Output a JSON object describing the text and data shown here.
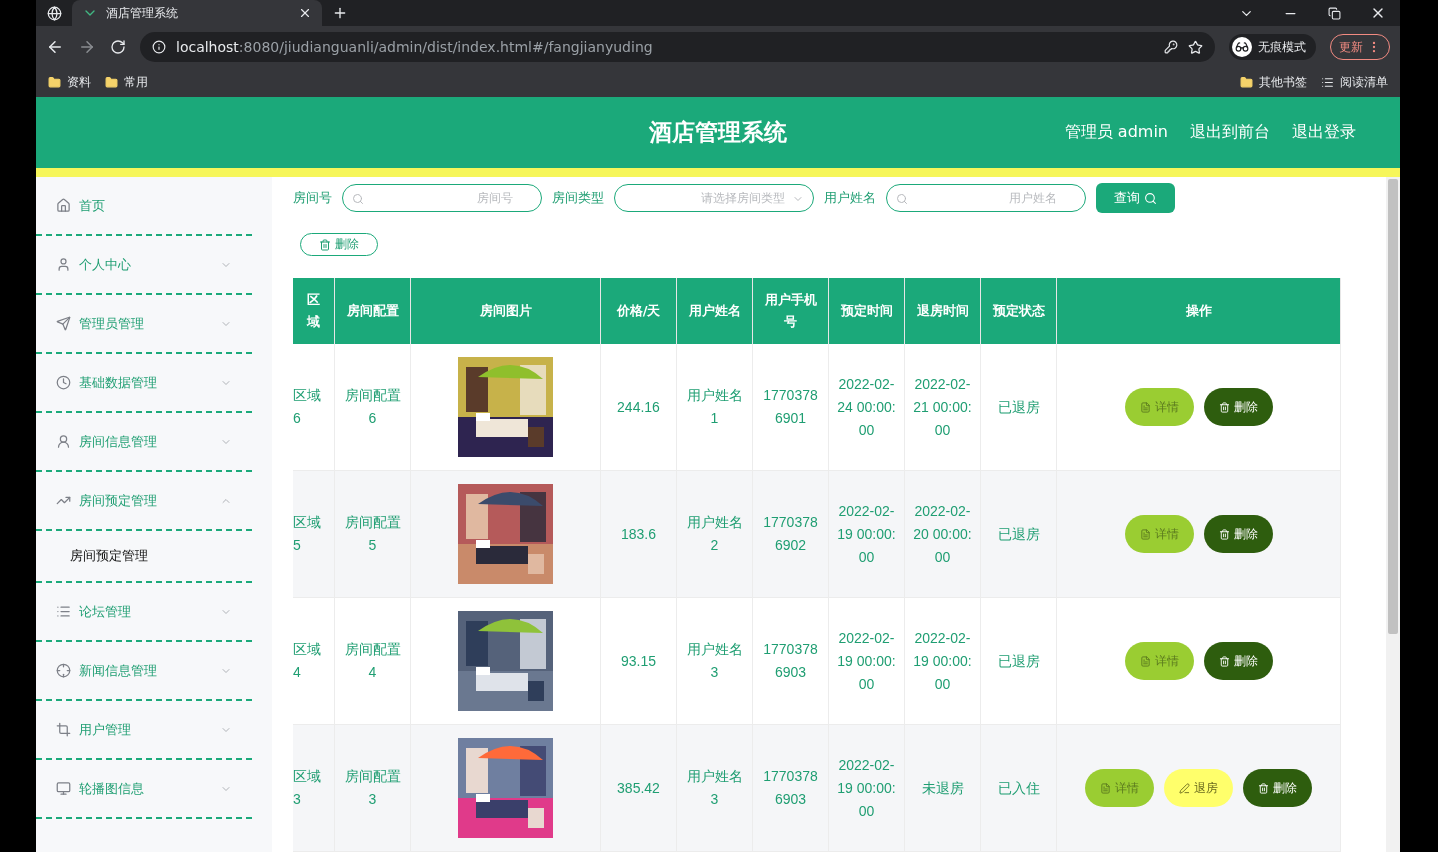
{
  "browser": {
    "tab_title": "酒店管理系统",
    "url_host": "localhost",
    "url_path": ":8080/jiudianguanli/admin/dist/index.html#/fangjianyuding",
    "profile": "无痕模式",
    "update": "更新",
    "bookmarks": [
      "资料",
      "常用"
    ],
    "right_bookmarks": [
      {
        "kind": "folder",
        "label": "其他书签"
      },
      {
        "kind": "list",
        "label": "阅读清单"
      }
    ]
  },
  "header": {
    "title": "酒店管理系统",
    "links": [
      "管理员 admin",
      "退出到前台",
      "退出登录"
    ]
  },
  "sidebar": {
    "items": [
      {
        "kind": "link",
        "label": "首页"
      },
      {
        "kind": "menu",
        "label": "个人中心",
        "expanded": false
      },
      {
        "kind": "menu",
        "label": "管理员管理",
        "expanded": false
      },
      {
        "kind": "menu",
        "label": "基础数据管理",
        "expanded": false
      },
      {
        "kind": "menu",
        "label": "房间信息管理",
        "expanded": false
      },
      {
        "kind": "menu",
        "label": "房间预定管理",
        "expanded": true,
        "children": [
          {
            "label": "房间预定管理"
          }
        ]
      },
      {
        "kind": "menu",
        "label": "论坛管理",
        "expanded": false
      },
      {
        "kind": "menu",
        "label": "新闻信息管理",
        "expanded": false
      },
      {
        "kind": "menu",
        "label": "用户管理",
        "expanded": false
      },
      {
        "kind": "menu",
        "label": "轮播图信息",
        "expanded": false
      }
    ]
  },
  "search": {
    "fields": [
      {
        "kind": "text",
        "label": "房间号",
        "placeholder": "房间号"
      },
      {
        "kind": "select",
        "label": "房间类型",
        "placeholder": "请选择房间类型"
      },
      {
        "kind": "text",
        "label": "用户姓名",
        "placeholder": "用户姓名"
      }
    ],
    "button": "查询"
  },
  "delete_button": "删除",
  "table": {
    "columns": [
      "区域",
      "房间配置",
      "房间图片",
      "价格/天",
      "用户姓名",
      "用户手机号",
      "预定时间",
      "退房时间",
      "预定状态",
      "操作"
    ],
    "rows": [
      {
        "area": "区域6",
        "config": "房间配置6",
        "photo": {
          "kind": "picture"
        },
        "price": "244.16",
        "name": "用户姓名1",
        "phone": "17703786901",
        "book_time": "2022-02-24 00:00:00",
        "checkout_time": "2022-02-21 00:00:00",
        "status": "已退房",
        "actions": [
          {
            "kind": "detail",
            "label": "详情"
          },
          {
            "kind": "delete",
            "label": "删除"
          }
        ]
      },
      {
        "area": "区域5",
        "config": "房间配置5",
        "photo": {
          "kind": "picture"
        },
        "price": "183.6",
        "name": "用户姓名2",
        "phone": "17703786902",
        "book_time": "2022-02-19 00:00:00",
        "checkout_time": "2022-02-20 00:00:00",
        "status": "已退房",
        "actions": [
          {
            "kind": "detail",
            "label": "详情"
          },
          {
            "kind": "delete",
            "label": "删除"
          }
        ]
      },
      {
        "area": "区域4",
        "config": "房间配置4",
        "photo": {
          "kind": "picture"
        },
        "price": "93.15",
        "name": "用户姓名3",
        "phone": "17703786903",
        "book_time": "2022-02-19 00:00:00",
        "checkout_time": "2022-02-19 00:00:00",
        "status": "已退房",
        "actions": [
          {
            "kind": "detail",
            "label": "详情"
          },
          {
            "kind": "delete",
            "label": "删除"
          }
        ]
      },
      {
        "area": "区域3",
        "config": "房间配置3",
        "photo": {
          "kind": "picture"
        },
        "price": "385.42",
        "name": "用户姓名3",
        "phone": "17703786903",
        "book_time": "2022-02-19 00:00:00",
        "checkout_time": "未退房",
        "status": "已入住",
        "actions": [
          {
            "kind": "detail",
            "label": "详情"
          },
          {
            "kind": "checkout",
            "label": "退房"
          },
          {
            "kind": "delete",
            "label": "删除"
          }
        ]
      }
    ]
  }
}
